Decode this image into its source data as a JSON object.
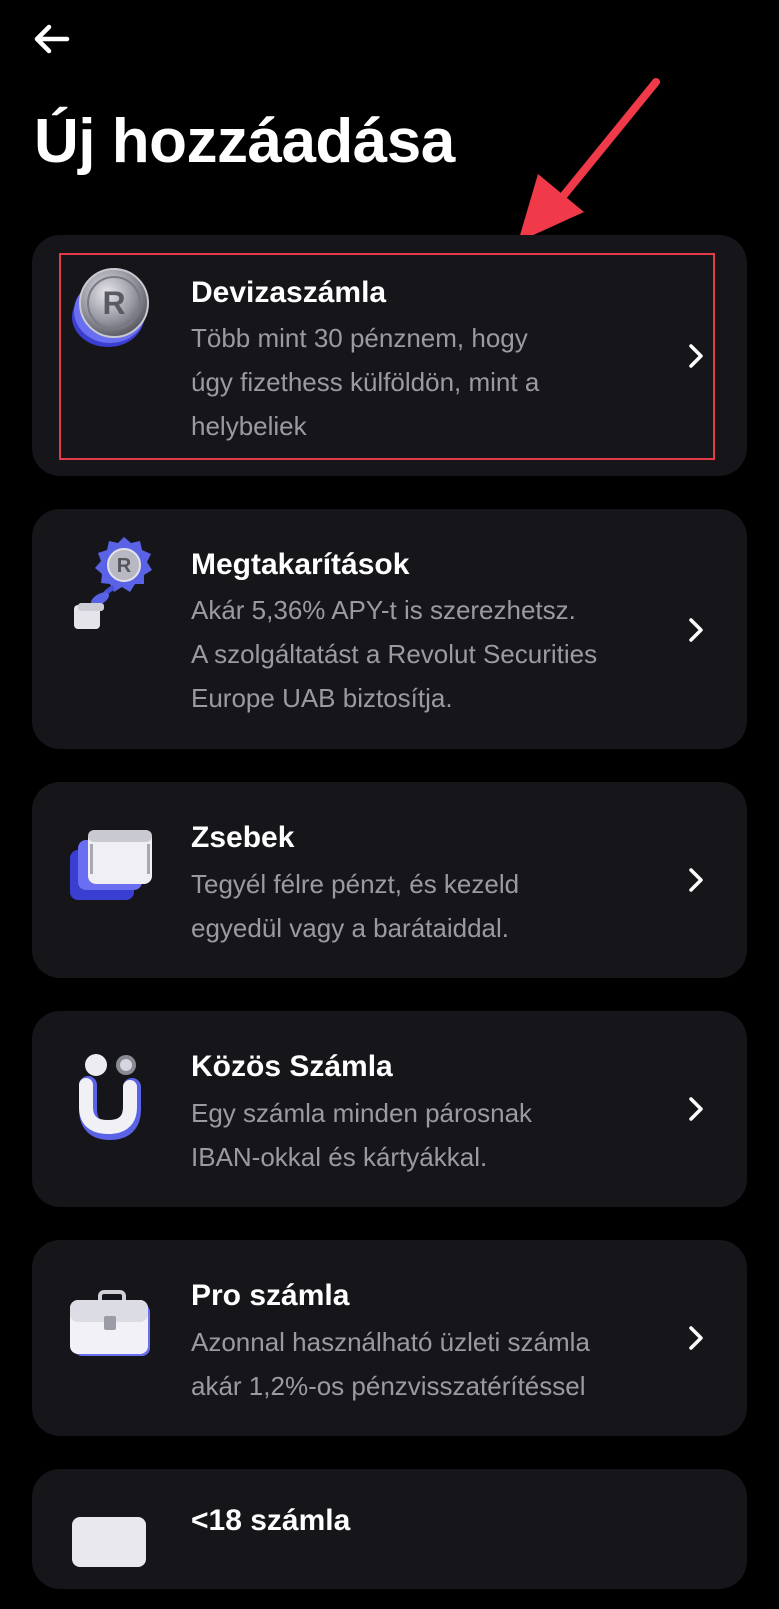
{
  "header": {
    "back_icon": "arrow-left-icon",
    "title": "Új hozzáadása"
  },
  "annotation": {
    "arrow_color": "#f03a4a",
    "highlight_color": "#e23a46"
  },
  "cards": [
    {
      "title": "Devizaszámla",
      "desc1": "Több mint 30 pénznem, hogy",
      "desc2": "úgy fizethess külföldön, mint a",
      "desc3": "helybeliek",
      "icon": "revolut-coin-icon"
    },
    {
      "title": "Megtakarítások",
      "desc1": "Akár 5,36% APY-t is szerezhetsz.",
      "desc2": "A szolgáltatást a Revolut Securities",
      "desc3": "Europe UAB biztosítja.",
      "icon": "savings-flower-icon"
    },
    {
      "title": "Zsebek",
      "desc1": "Tegyél félre pénzt, és kezeld",
      "desc2": "egyedül vagy a barátaiddal.",
      "icon": "pockets-stack-icon"
    },
    {
      "title": "Közös Számla",
      "desc1": "Egy számla minden párosnak",
      "desc2": "IBAN-okkal és kártyákkal.",
      "icon": "joint-account-icon"
    },
    {
      "title": "Pro számla",
      "desc1": "Azonnal használható üzleti számla",
      "desc2": "akár 1,2%-os pénzvisszatérítéssel",
      "icon": "briefcase-icon"
    },
    {
      "title": "<18 számla",
      "icon": "card-icon"
    }
  ],
  "colors": {
    "background": "#000000",
    "card": "#16161a",
    "text_primary": "#ffffff",
    "text_secondary": "#9a9aa3",
    "accent_blue": "#5a62e6"
  }
}
